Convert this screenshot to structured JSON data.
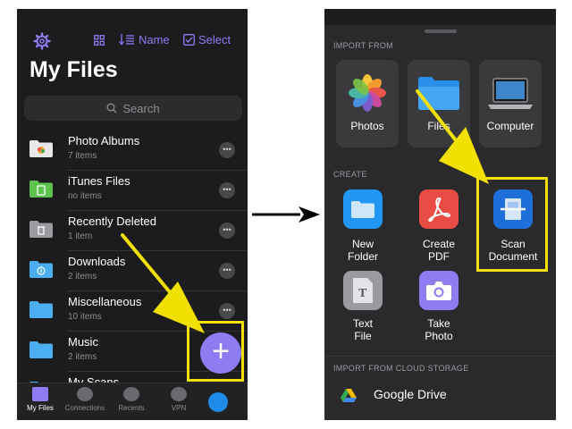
{
  "left": {
    "toolbar": {
      "sort_label": "Name",
      "select_label": "Select"
    },
    "title": "My Files",
    "search_placeholder": "Search",
    "files": [
      {
        "name": "Photo Albums",
        "count": "7 items"
      },
      {
        "name": "iTunes Files",
        "count": "no items"
      },
      {
        "name": "Recently Deleted",
        "count": "1 item"
      },
      {
        "name": "Downloads",
        "count": "2 items"
      },
      {
        "name": "Miscellaneous",
        "count": "10 items"
      },
      {
        "name": "Music",
        "count": "2 items"
      },
      {
        "name": "My Scans",
        "count": ""
      }
    ],
    "tabs": [
      "My Files",
      "Connections",
      "Recents",
      "VPN"
    ],
    "fab_symbol": "+"
  },
  "right": {
    "import_header": "IMPORT FROM",
    "import": [
      "Photos",
      "Files",
      "Computer"
    ],
    "create_header": "CREATE",
    "create": [
      {
        "line1": "New",
        "line2": "Folder"
      },
      {
        "line1": "Create",
        "line2": "PDF"
      },
      {
        "line1": "Scan",
        "line2": "Document"
      },
      {
        "line1": "Text",
        "line2": "File"
      },
      {
        "line1": "Take",
        "line2": "Photo"
      }
    ],
    "cloud_header": "IMPORT FROM CLOUD STORAGE",
    "cloud_first": "Google Drive"
  },
  "colors": {
    "accent": "#8e7cf2",
    "highlight": "#f2e000",
    "background": "#1c1c1e"
  }
}
